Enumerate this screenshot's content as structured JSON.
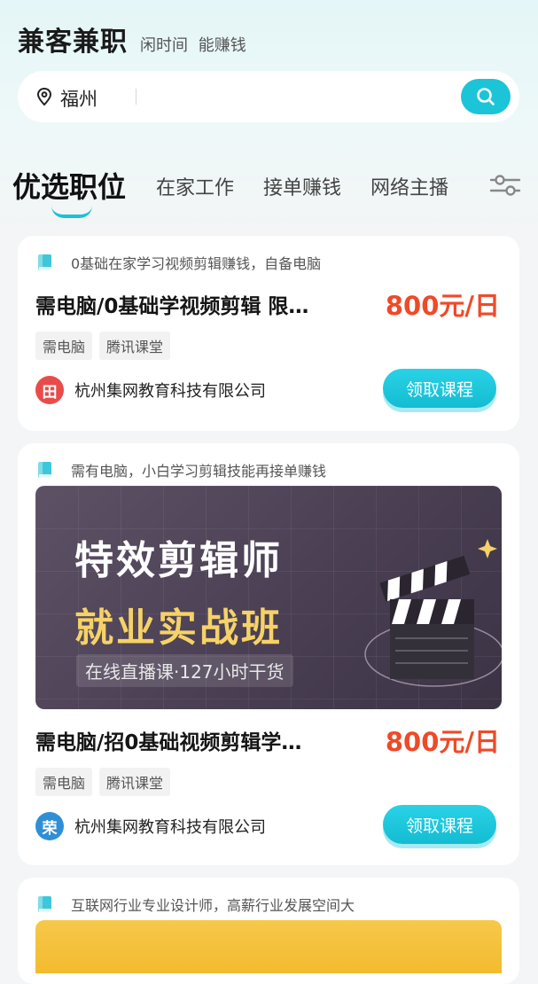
{
  "header": {
    "title": "兼客兼职",
    "tagline": "闲时间 能赚钱"
  },
  "search": {
    "city": "福州"
  },
  "tabs": [
    "优选职位",
    "在家工作",
    "接单赚钱",
    "网络主播"
  ],
  "jobs": [
    {
      "subtitle": "0基础在家学习视频剪辑赚钱，自备电脑",
      "title": "需电脑/0基础学视频剪辑 限…",
      "salary": "800元/日",
      "tags": [
        "需电脑",
        "腾讯课堂"
      ],
      "avatar_char": "田",
      "avatar_color": "#e94b4b",
      "company": "杭州集网教育科技有限公司",
      "cta": "领取课程"
    },
    {
      "subtitle": "需有电脑，小白学习剪辑技能再接单赚钱",
      "banner": {
        "line1": "特效剪辑师",
        "line2": "就业实战班",
        "line3": "在线直播课·127小时干货"
      },
      "title": "需电脑/招0基础视频剪辑学…",
      "salary": "800元/日",
      "tags": [
        "需电脑",
        "腾讯课堂"
      ],
      "avatar_char": "荣",
      "avatar_color": "#2f8fd6",
      "company": "杭州集网教育科技有限公司",
      "cta": "领取课程"
    },
    {
      "subtitle": "互联网行业专业设计师，高薪行业发展空间大"
    }
  ],
  "colors": {
    "accent": "#1cc4d8",
    "salary": "#ef4a28"
  },
  "icons": [
    "location-pin-icon",
    "search-icon",
    "filter-sliders-icon",
    "book-icon",
    "clapperboard-icon"
  ]
}
